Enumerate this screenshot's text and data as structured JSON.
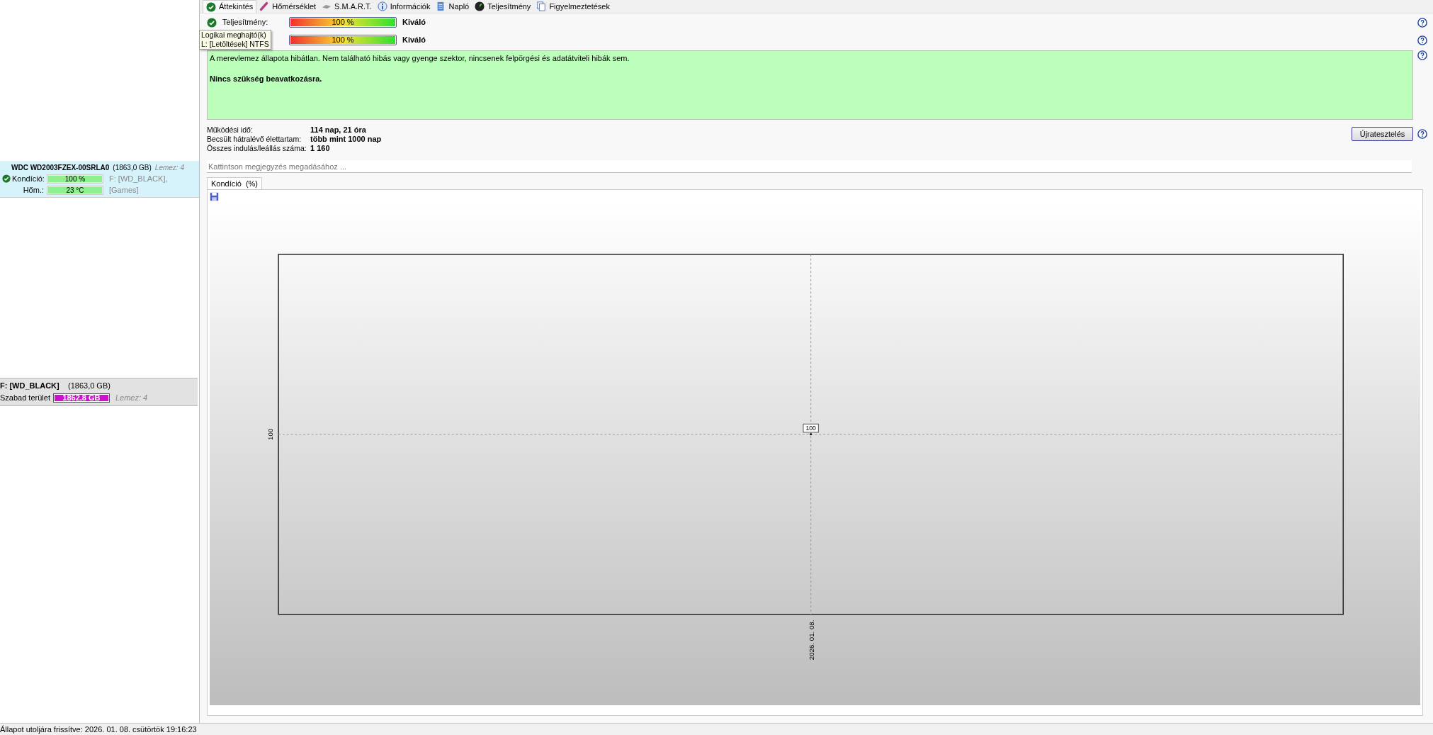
{
  "tabs": [
    {
      "label": "Áttekintés",
      "selected": true
    },
    {
      "label": "Hőmérséklet",
      "selected": false
    },
    {
      "label": "S.M.A.R.T.",
      "selected": false
    },
    {
      "label": "Információk",
      "selected": false
    },
    {
      "label": "Napló",
      "selected": false
    },
    {
      "label": "Teljesítmény",
      "selected": false
    },
    {
      "label": "Figyelmeztetések",
      "selected": false
    }
  ],
  "sidebar": {
    "disk": {
      "name": "WDC WD2003FZEX-00SRLA0",
      "size": "(1863,0 GB)",
      "disk_no": "Lemez: 4",
      "selected": true,
      "rows": [
        {
          "label": "Kondíció:",
          "value": "100 %",
          "level": 1,
          "note": "F: [WD_BLACK],"
        },
        {
          "label": "Hőm.:",
          "value": "23 °C",
          "level": 1,
          "note": "[Games]"
        }
      ]
    },
    "partition": {
      "name": "F: [WD_BLACK]",
      "size": "(1863,0 GB)",
      "free_label": "Szabad terület",
      "free": "1862,8 GB",
      "level": 1,
      "disk_no": "Lemez: 4"
    }
  },
  "status_rows": [
    {
      "label": "Teljesítmény:",
      "value": "100 %",
      "level": 1,
      "rating": "Kiváló"
    },
    {
      "value": "100 %",
      "level": 1,
      "rating": "Kiváló"
    }
  ],
  "tooltip": [
    "Logikai meghajtó(k)",
    "L: [Letöltések] NTFS"
  ],
  "message": {
    "text": "A merevlemez állapota hibátlan. Nem található hibás vagy gyenge szektor, nincsenek felpörgési és adatátviteli hibák sem.",
    "advice": "Nincs szükség beavatkozásra."
  },
  "info": [
    {
      "label": "Működési idő:",
      "value": "114 nap, 21 óra"
    },
    {
      "label": "Becsült hátralévő élettartam:",
      "value": "több mint 1000 nap"
    },
    {
      "label": "Összes indulás/leállás száma:",
      "value": "1 160"
    }
  ],
  "retest_button": "Újratesztelés",
  "note_field": {
    "placeholder": "Kattintson megjegyzés megadásához ..."
  },
  "chart_tab": {
    "label": "Kondíció  (%)",
    "selected": true
  },
  "chart": {
    "y_label": "100",
    "x_label": "2026. 01. 08.",
    "point_label": "100"
  },
  "status_bar": "Állapot utoljára frissítve: 2026. 01. 08. csütörtök 19:16:23"
}
